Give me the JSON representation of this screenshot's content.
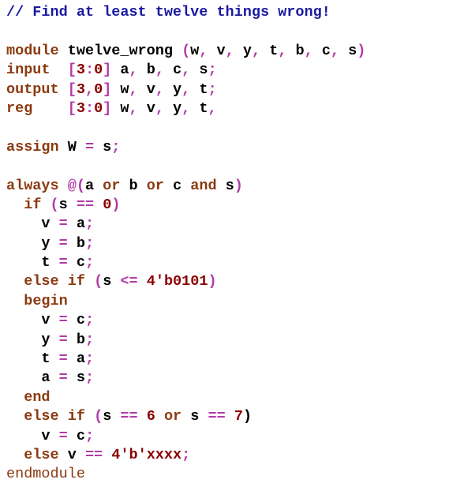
{
  "lines": [
    [
      {
        "t": "// Find at least twelve things wrong!",
        "c": "cm"
      }
    ],
    [],
    [
      {
        "t": "module",
        "c": "kw"
      },
      {
        "t": " twelve_wrong ",
        "c": "id"
      },
      {
        "t": "(",
        "c": "op"
      },
      {
        "t": "w",
        "c": "id"
      },
      {
        "t": ",",
        "c": "op"
      },
      {
        "t": " v",
        "c": "id"
      },
      {
        "t": ",",
        "c": "op"
      },
      {
        "t": " y",
        "c": "id"
      },
      {
        "t": ",",
        "c": "op"
      },
      {
        "t": " t",
        "c": "id"
      },
      {
        "t": ",",
        "c": "op"
      },
      {
        "t": " b",
        "c": "id"
      },
      {
        "t": ",",
        "c": "op"
      },
      {
        "t": " c",
        "c": "id"
      },
      {
        "t": ",",
        "c": "op"
      },
      {
        "t": " s",
        "c": "id"
      },
      {
        "t": ")",
        "c": "op"
      }
    ],
    [
      {
        "t": "input",
        "c": "kw"
      },
      {
        "t": "  ",
        "c": "ws"
      },
      {
        "t": "[",
        "c": "op"
      },
      {
        "t": "3",
        "c": "num"
      },
      {
        "t": ":",
        "c": "op"
      },
      {
        "t": "0",
        "c": "num"
      },
      {
        "t": "]",
        "c": "op"
      },
      {
        "t": " a",
        "c": "id"
      },
      {
        "t": ",",
        "c": "op"
      },
      {
        "t": " b",
        "c": "id"
      },
      {
        "t": ",",
        "c": "op"
      },
      {
        "t": " c",
        "c": "id"
      },
      {
        "t": ",",
        "c": "op"
      },
      {
        "t": " s",
        "c": "id"
      },
      {
        "t": ";",
        "c": "op"
      }
    ],
    [
      {
        "t": "output",
        "c": "kw"
      },
      {
        "t": " ",
        "c": "ws"
      },
      {
        "t": "[",
        "c": "op"
      },
      {
        "t": "3",
        "c": "num"
      },
      {
        "t": ",",
        "c": "op"
      },
      {
        "t": "0",
        "c": "num"
      },
      {
        "t": "]",
        "c": "op"
      },
      {
        "t": " w",
        "c": "id"
      },
      {
        "t": ",",
        "c": "op"
      },
      {
        "t": " v",
        "c": "id"
      },
      {
        "t": ",",
        "c": "op"
      },
      {
        "t": " y",
        "c": "id"
      },
      {
        "t": ",",
        "c": "op"
      },
      {
        "t": " t",
        "c": "id"
      },
      {
        "t": ";",
        "c": "op"
      }
    ],
    [
      {
        "t": "reg",
        "c": "kw"
      },
      {
        "t": "    ",
        "c": "ws"
      },
      {
        "t": "[",
        "c": "op"
      },
      {
        "t": "3",
        "c": "num"
      },
      {
        "t": ":",
        "c": "op"
      },
      {
        "t": "0",
        "c": "num"
      },
      {
        "t": "]",
        "c": "op"
      },
      {
        "t": " w",
        "c": "id"
      },
      {
        "t": ",",
        "c": "op"
      },
      {
        "t": " v",
        "c": "id"
      },
      {
        "t": ",",
        "c": "op"
      },
      {
        "t": " y",
        "c": "id"
      },
      {
        "t": ",",
        "c": "op"
      },
      {
        "t": " t",
        "c": "id"
      },
      {
        "t": ",",
        "c": "op"
      }
    ],
    [],
    [
      {
        "t": "assign",
        "c": "kw"
      },
      {
        "t": " W ",
        "c": "id"
      },
      {
        "t": "=",
        "c": "op"
      },
      {
        "t": " s",
        "c": "id"
      },
      {
        "t": ";",
        "c": "op"
      }
    ],
    [],
    [
      {
        "t": "always",
        "c": "kw"
      },
      {
        "t": " ",
        "c": "ws"
      },
      {
        "t": "@",
        "c": "op"
      },
      {
        "t": "(",
        "c": "op"
      },
      {
        "t": "a ",
        "c": "id"
      },
      {
        "t": "or",
        "c": "kw"
      },
      {
        "t": " b ",
        "c": "id"
      },
      {
        "t": "or",
        "c": "kw"
      },
      {
        "t": " c ",
        "c": "id"
      },
      {
        "t": "and",
        "c": "kw"
      },
      {
        "t": " s",
        "c": "id"
      },
      {
        "t": ")",
        "c": "op"
      }
    ],
    [
      {
        "t": "  ",
        "c": "ws"
      },
      {
        "t": "if",
        "c": "kw"
      },
      {
        "t": " ",
        "c": "ws"
      },
      {
        "t": "(",
        "c": "op"
      },
      {
        "t": "s ",
        "c": "id"
      },
      {
        "t": "==",
        "c": "op"
      },
      {
        "t": " ",
        "c": "ws"
      },
      {
        "t": "0",
        "c": "num"
      },
      {
        "t": ")",
        "c": "op"
      }
    ],
    [
      {
        "t": "    v ",
        "c": "id"
      },
      {
        "t": "=",
        "c": "op"
      },
      {
        "t": " a",
        "c": "id"
      },
      {
        "t": ";",
        "c": "op"
      }
    ],
    [
      {
        "t": "    y ",
        "c": "id"
      },
      {
        "t": "=",
        "c": "op"
      },
      {
        "t": " b",
        "c": "id"
      },
      {
        "t": ";",
        "c": "op"
      }
    ],
    [
      {
        "t": "    t ",
        "c": "id"
      },
      {
        "t": "=",
        "c": "op"
      },
      {
        "t": " c",
        "c": "id"
      },
      {
        "t": ";",
        "c": "op"
      }
    ],
    [
      {
        "t": "  ",
        "c": "ws"
      },
      {
        "t": "else",
        "c": "kw"
      },
      {
        "t": " ",
        "c": "ws"
      },
      {
        "t": "if",
        "c": "kw"
      },
      {
        "t": " ",
        "c": "ws"
      },
      {
        "t": "(",
        "c": "op"
      },
      {
        "t": "s ",
        "c": "id"
      },
      {
        "t": "<=",
        "c": "op"
      },
      {
        "t": " ",
        "c": "ws"
      },
      {
        "t": "4'b0101",
        "c": "num"
      },
      {
        "t": ")",
        "c": "op"
      }
    ],
    [
      {
        "t": "  ",
        "c": "ws"
      },
      {
        "t": "begin",
        "c": "kw"
      }
    ],
    [
      {
        "t": "    v ",
        "c": "id"
      },
      {
        "t": "=",
        "c": "op"
      },
      {
        "t": " c",
        "c": "id"
      },
      {
        "t": ";",
        "c": "op"
      }
    ],
    [
      {
        "t": "    y ",
        "c": "id"
      },
      {
        "t": "=",
        "c": "op"
      },
      {
        "t": " b",
        "c": "id"
      },
      {
        "t": ";",
        "c": "op"
      }
    ],
    [
      {
        "t": "    t ",
        "c": "id"
      },
      {
        "t": "=",
        "c": "op"
      },
      {
        "t": " a",
        "c": "id"
      },
      {
        "t": ";",
        "c": "op"
      }
    ],
    [
      {
        "t": "    a ",
        "c": "id"
      },
      {
        "t": "=",
        "c": "op"
      },
      {
        "t": " s",
        "c": "id"
      },
      {
        "t": ";",
        "c": "op"
      }
    ],
    [
      {
        "t": "  ",
        "c": "ws"
      },
      {
        "t": "end",
        "c": "kw"
      }
    ],
    [
      {
        "t": "  ",
        "c": "ws"
      },
      {
        "t": "else",
        "c": "kw"
      },
      {
        "t": " ",
        "c": "ws"
      },
      {
        "t": "if",
        "c": "kw"
      },
      {
        "t": " ",
        "c": "ws"
      },
      {
        "t": "(",
        "c": "op"
      },
      {
        "t": "s ",
        "c": "id"
      },
      {
        "t": "==",
        "c": "op"
      },
      {
        "t": " ",
        "c": "ws"
      },
      {
        "t": "6",
        "c": "num"
      },
      {
        "t": " ",
        "c": "ws"
      },
      {
        "t": "or",
        "c": "kw"
      },
      {
        "t": " s ",
        "c": "id"
      },
      {
        "t": "==",
        "c": "op"
      },
      {
        "t": " ",
        "c": "ws"
      },
      {
        "t": "7",
        "c": "num"
      },
      {
        "t": ")",
        "c": "id"
      }
    ],
    [
      {
        "t": "    v ",
        "c": "id"
      },
      {
        "t": "=",
        "c": "op"
      },
      {
        "t": " c",
        "c": "id"
      },
      {
        "t": ";",
        "c": "op"
      }
    ],
    [
      {
        "t": "  ",
        "c": "ws"
      },
      {
        "t": "else",
        "c": "kw"
      },
      {
        "t": " v ",
        "c": "id"
      },
      {
        "t": "==",
        "c": "op"
      },
      {
        "t": " ",
        "c": "ws"
      },
      {
        "t": "4'b'xxxx",
        "c": "num"
      },
      {
        "t": ";",
        "c": "op"
      }
    ],
    [
      {
        "t": "endmodule",
        "c": "plain"
      }
    ]
  ]
}
